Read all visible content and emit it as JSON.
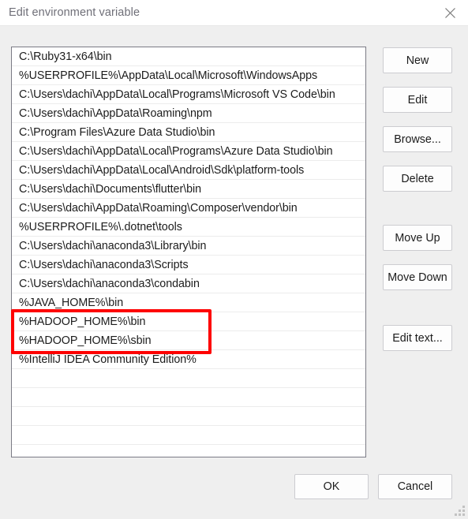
{
  "window": {
    "title": "Edit environment variable",
    "close_icon": "close-icon"
  },
  "list": {
    "items": [
      "C:\\Ruby31-x64\\bin",
      "%USERPROFILE%\\AppData\\Local\\Microsoft\\WindowsApps",
      "C:\\Users\\dachi\\AppData\\Local\\Programs\\Microsoft VS Code\\bin",
      "C:\\Users\\dachi\\AppData\\Roaming\\npm",
      "C:\\Program Files\\Azure Data Studio\\bin",
      "C:\\Users\\dachi\\AppData\\Local\\Programs\\Azure Data Studio\\bin",
      "C:\\Users\\dachi\\AppData\\Local\\Android\\Sdk\\platform-tools",
      "C:\\Users\\dachi\\Documents\\flutter\\bin",
      "C:\\Users\\dachi\\AppData\\Roaming\\Composer\\vendor\\bin",
      "%USERPROFILE%\\.dotnet\\tools",
      "C:\\Users\\dachi\\anaconda3\\Library\\bin",
      "C:\\Users\\dachi\\anaconda3\\Scripts",
      "C:\\Users\\dachi\\anaconda3\\condabin",
      "%JAVA_HOME%\\bin",
      "%HADOOP_HOME%\\bin",
      "%HADOOP_HOME%\\sbin",
      "%IntelliJ IDEA Community Edition%"
    ],
    "empty_row_count": 6
  },
  "buttons": {
    "new": "New",
    "edit": "Edit",
    "browse": "Browse...",
    "delete": "Delete",
    "move_up": "Move Up",
    "move_down": "Move Down",
    "edit_text": "Edit text...",
    "ok": "OK",
    "cancel": "Cancel"
  },
  "annotation": {
    "color": "#fe0000",
    "highlights": [
      "%HADOOP_HOME%\\bin",
      "%HADOOP_HOME%\\sbin"
    ]
  }
}
